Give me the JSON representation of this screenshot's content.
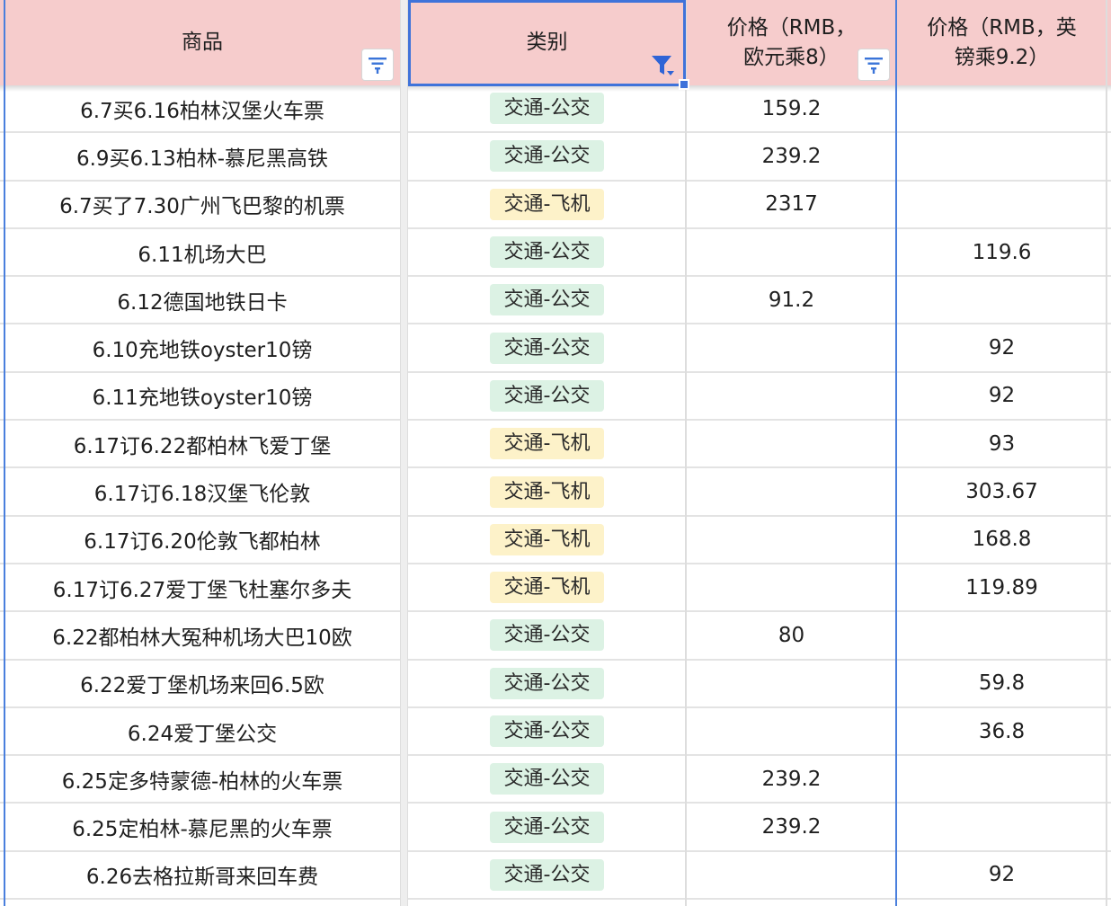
{
  "headers": {
    "col1": "商品",
    "col2": "类别",
    "col3": "价格（RMB，\n欧元乘8）",
    "col4": "价格（RMB，英\n镑乘9.2）"
  },
  "icons": {
    "filter": "filter-icon",
    "filter_active": "filter-active-icon"
  },
  "colors": {
    "header_bg": "#f6cccc",
    "selection": "#3f73da",
    "tag_bus_bg": "#dcf2e4",
    "tag_plane_bg": "#fdf2c9"
  },
  "rows": [
    {
      "item": "6.7买6.16柏林汉堡火车票",
      "category": "交通-公交",
      "cat_type": "bus",
      "eur_rmb": "159.2",
      "gbp_rmb": ""
    },
    {
      "item": "6.9买6.13柏林-慕尼黑高铁",
      "category": "交通-公交",
      "cat_type": "bus",
      "eur_rmb": "239.2",
      "gbp_rmb": ""
    },
    {
      "item": "6.7买了7.30广州飞巴黎的机票",
      "category": "交通-飞机",
      "cat_type": "plane",
      "eur_rmb": "2317",
      "gbp_rmb": ""
    },
    {
      "item": "6.11机场大巴",
      "category": "交通-公交",
      "cat_type": "bus",
      "eur_rmb": "",
      "gbp_rmb": "119.6"
    },
    {
      "item": "6.12德国地铁日卡",
      "category": "交通-公交",
      "cat_type": "bus",
      "eur_rmb": "91.2",
      "gbp_rmb": ""
    },
    {
      "item": "6.10充地铁oyster10镑",
      "category": "交通-公交",
      "cat_type": "bus",
      "eur_rmb": "",
      "gbp_rmb": "92"
    },
    {
      "item": "6.11充地铁oyster10镑",
      "category": "交通-公交",
      "cat_type": "bus",
      "eur_rmb": "",
      "gbp_rmb": "92"
    },
    {
      "item": "6.17订6.22都柏林飞爱丁堡",
      "category": "交通-飞机",
      "cat_type": "plane",
      "eur_rmb": "",
      "gbp_rmb": "93"
    },
    {
      "item": "6.17订6.18汉堡飞伦敦",
      "category": "交通-飞机",
      "cat_type": "plane",
      "eur_rmb": "",
      "gbp_rmb": "303.67"
    },
    {
      "item": "6.17订6.20伦敦飞都柏林",
      "category": "交通-飞机",
      "cat_type": "plane",
      "eur_rmb": "",
      "gbp_rmb": "168.8"
    },
    {
      "item": "6.17订6.27爱丁堡飞杜塞尔多夫",
      "category": "交通-飞机",
      "cat_type": "plane",
      "eur_rmb": "",
      "gbp_rmb": "119.89"
    },
    {
      "item": "6.22都柏林大冤种机场大巴10欧",
      "category": "交通-公交",
      "cat_type": "bus",
      "eur_rmb": "80",
      "gbp_rmb": ""
    },
    {
      "item": "6.22爱丁堡机场来回6.5欧",
      "category": "交通-公交",
      "cat_type": "bus",
      "eur_rmb": "",
      "gbp_rmb": "59.8"
    },
    {
      "item": "6.24爱丁堡公交",
      "category": "交通-公交",
      "cat_type": "bus",
      "eur_rmb": "",
      "gbp_rmb": "36.8"
    },
    {
      "item": "6.25定多特蒙德-柏林的火车票",
      "category": "交通-公交",
      "cat_type": "bus",
      "eur_rmb": "239.2",
      "gbp_rmb": ""
    },
    {
      "item": "6.25定柏林-慕尼黑的火车票",
      "category": "交通-公交",
      "cat_type": "bus",
      "eur_rmb": "239.2",
      "gbp_rmb": ""
    },
    {
      "item": "6.26去格拉斯哥来回车费",
      "category": "交通-公交",
      "cat_type": "bus",
      "eur_rmb": "",
      "gbp_rmb": "92"
    }
  ]
}
